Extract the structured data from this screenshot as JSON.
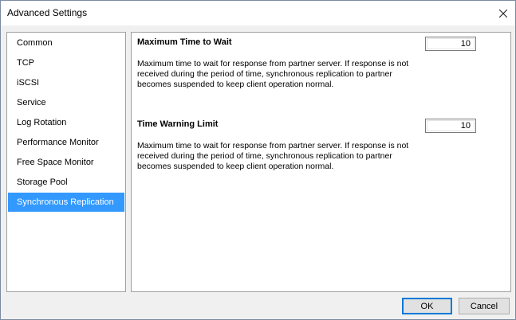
{
  "window": {
    "title": "Advanced Settings",
    "close_icon": "close-icon"
  },
  "sidebar": {
    "items": [
      {
        "label": "Common"
      },
      {
        "label": "TCP"
      },
      {
        "label": "iSCSI"
      },
      {
        "label": "Service"
      },
      {
        "label": "Log Rotation"
      },
      {
        "label": "Performance Monitor"
      },
      {
        "label": "Free Space Monitor"
      },
      {
        "label": "Storage Pool"
      },
      {
        "label": "Synchronous Replication",
        "selected": true
      }
    ],
    "selected_color": "#3399ff"
  },
  "content": {
    "max_time": {
      "title": "Maximum Time to Wait",
      "value": "10",
      "description": "Maximum time to wait for response from partner server. If response is not received during the period of time, synchronous replication to partner becomes suspended to keep client operation normal."
    },
    "warning_limit": {
      "title": "Time Warning Limit",
      "value": "10",
      "description": "Maximum time to wait for response from partner server. If response is not received during the period of time, synchronous replication to partner becomes suspended to keep client operation normal."
    }
  },
  "buttons": {
    "ok_label": "OK",
    "cancel_label": "Cancel"
  }
}
